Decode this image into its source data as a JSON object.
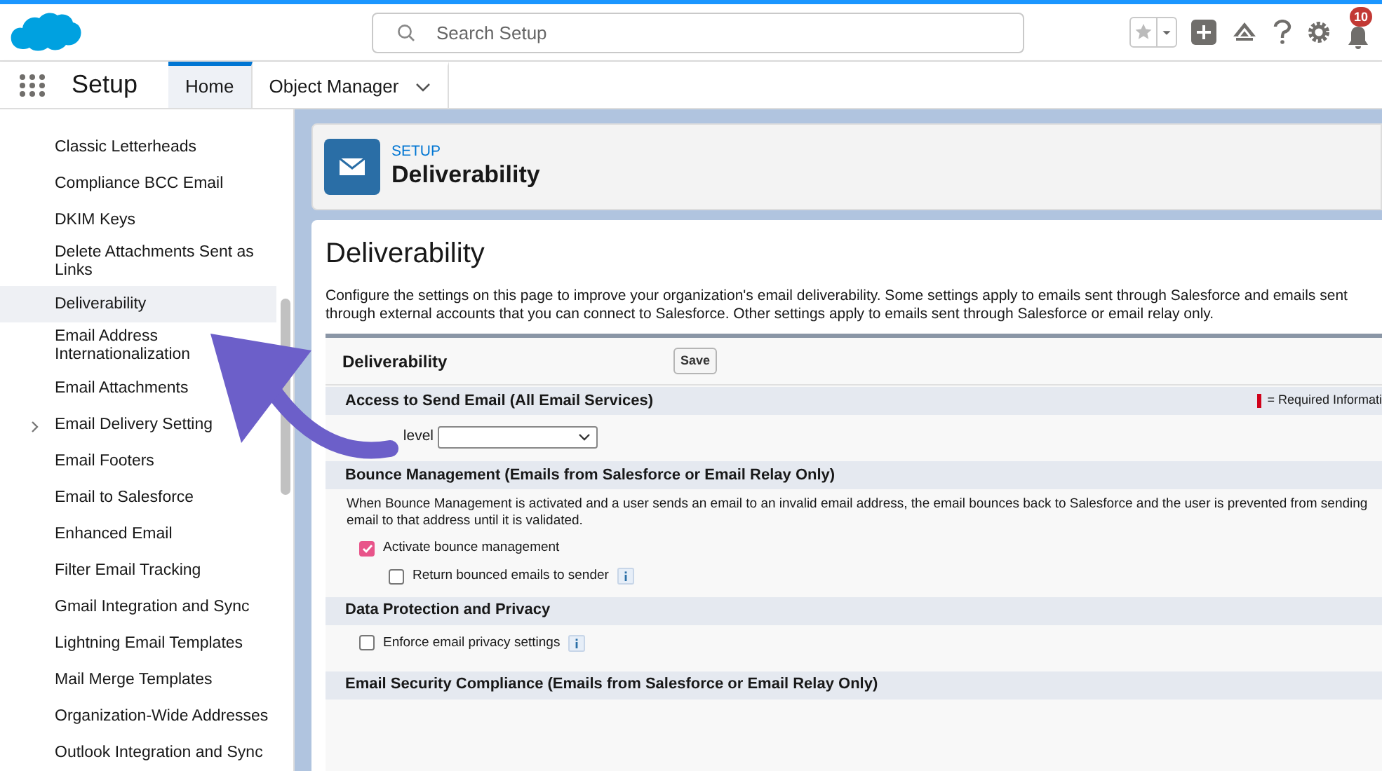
{
  "header": {
    "search": {
      "placeholder": "Search Setup"
    },
    "notifications": "10"
  },
  "nav": {
    "app": "Setup",
    "tabs": [
      {
        "label": "Home",
        "selected": true,
        "dropdown": false
      },
      {
        "label": "Object Manager",
        "selected": false,
        "dropdown": true
      }
    ]
  },
  "sidebar": {
    "items": [
      {
        "label": "Classic Letterheads",
        "selected": false,
        "expandable": false
      },
      {
        "label": "Compliance BCC Email",
        "selected": false,
        "expandable": false
      },
      {
        "label": "DKIM Keys",
        "selected": false,
        "expandable": false
      },
      {
        "label": "Delete Attachments Sent as Links",
        "selected": false,
        "expandable": false
      },
      {
        "label": "Deliverability",
        "selected": true,
        "expandable": false
      },
      {
        "label": "Email Address Internationalization",
        "selected": false,
        "expandable": false
      },
      {
        "label": "Email Attachments",
        "selected": false,
        "expandable": false
      },
      {
        "label": "Email Delivery Setting",
        "selected": false,
        "expandable": true
      },
      {
        "label": "Email Footers",
        "selected": false,
        "expandable": false
      },
      {
        "label": "Email to Salesforce",
        "selected": false,
        "expandable": false
      },
      {
        "label": "Enhanced Email",
        "selected": false,
        "expandable": false
      },
      {
        "label": "Filter Email Tracking",
        "selected": false,
        "expandable": false
      },
      {
        "label": "Gmail Integration and Sync",
        "selected": false,
        "expandable": false
      },
      {
        "label": "Lightning Email Templates",
        "selected": false,
        "expandable": false
      },
      {
        "label": "Mail Merge Templates",
        "selected": false,
        "expandable": false
      },
      {
        "label": "Organization-Wide Addresses",
        "selected": false,
        "expandable": false
      },
      {
        "label": "Outlook Integration and Sync",
        "selected": false,
        "expandable": false
      }
    ]
  },
  "page_header": {
    "eyebrow": "SETUP",
    "title": "Deliverability"
  },
  "content": {
    "title": "Deliverability",
    "description": "Configure the settings on this page to improve your organization's email deliverability. Some settings apply to emails sent through Salesforce and emails sent through external accounts that you can connect to Salesforce. Other settings apply to emails sent through Salesforce or email relay only.",
    "panel_title": "Deliverability",
    "save": "Save",
    "sections": [
      {
        "title": "Access to Send Email (All Email Services)",
        "required_legend": "= Required Informati",
        "rows": [
          {
            "kind": "select",
            "label": "level"
          }
        ]
      },
      {
        "title": "Bounce Management (Emails from Salesforce or Email Relay Only)",
        "rows": [
          {
            "kind": "text",
            "text": "When Bounce Management is activated and a user sends an email to an invalid email address, the email bounces back to Salesforce and the user is prevented from sending email to that address until it is validated."
          },
          {
            "kind": "checkbox",
            "label": "Activate bounce management",
            "checked": true,
            "info": false,
            "children": [
              {
                "kind": "checkbox",
                "label": "Return bounced emails to sender",
                "checked": false,
                "info": true
              }
            ]
          }
        ]
      },
      {
        "title": "Data Protection and Privacy",
        "rows": [
          {
            "kind": "checkbox",
            "label": "Enforce email privacy settings",
            "checked": false,
            "info": true
          }
        ]
      },
      {
        "title": "Email Security Compliance (Emails from Salesforce or Email Relay Only)"
      }
    ]
  }
}
